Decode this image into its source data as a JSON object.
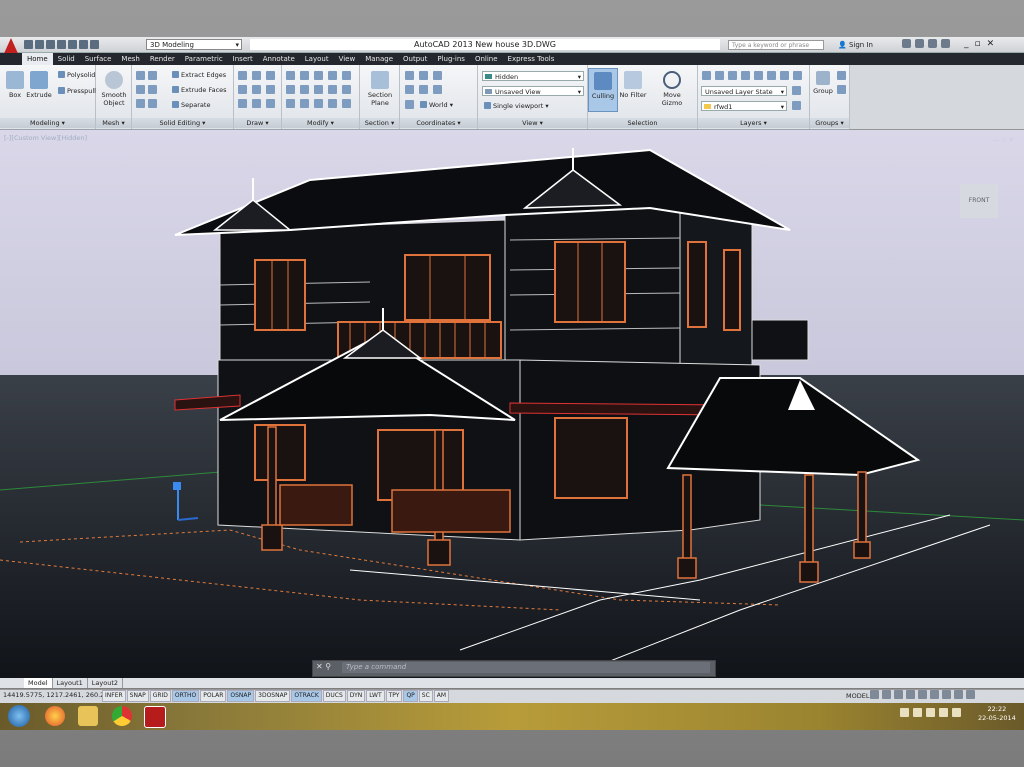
{
  "window": {
    "title": "AutoCAD 2013    New house 3D.DWG",
    "workspace": "3D Modeling",
    "search_placeholder": "Type a keyword or phrase",
    "sign_in": "Sign In",
    "controls": [
      "_",
      "▫",
      "✕"
    ]
  },
  "tabs": [
    "Home",
    "Solid",
    "Surface",
    "Mesh",
    "Render",
    "Parametric",
    "Insert",
    "Annotate",
    "Layout",
    "View",
    "Manage",
    "Output",
    "Plug-ins",
    "Online",
    "Express Tools"
  ],
  "ribbon": {
    "modeling": {
      "label": "Modeling",
      "box": "Box",
      "extrude": "Extrude",
      "polysolid": "Polysolid",
      "presspull": "Presspull"
    },
    "mesh": {
      "label": "Mesh",
      "smooth_object": "Smooth Object"
    },
    "solid_editing": {
      "label": "Solid Editing",
      "extract_edges": "Extract Edges",
      "extrude_faces": "Extrude Faces",
      "separate": "Separate"
    },
    "draw": {
      "label": "Draw"
    },
    "modify": {
      "label": "Modify"
    },
    "section": {
      "label": "Section",
      "section_plane": "Section Plane"
    },
    "coordinates": {
      "label": "Coordinates",
      "world": "World"
    },
    "view": {
      "label": "View",
      "visual_style": "Hidden",
      "saved_view": "Unsaved View",
      "viewport": "Single viewport"
    },
    "selection": {
      "label": "Selection",
      "culling": "Culling",
      "no_filter": "No Filter",
      "move_gizmo": "Move Gizmo"
    },
    "layers": {
      "label": "Layers",
      "layer_state": "Unsaved Layer State",
      "current_layer": "rfwd1"
    },
    "groups": {
      "label": "Groups",
      "group": "Group"
    }
  },
  "viewport": {
    "label": "[-][Custom View][Hidden]",
    "viewcube": "FRONT",
    "background_color": "#161a1f",
    "sky_color": "#d9d7e8",
    "wire_color": "#ffffff",
    "wood_color": "#e0733c"
  },
  "command": {
    "prompt": "Type a command"
  },
  "layout_tabs": [
    "Model",
    "Layout1",
    "Layout2"
  ],
  "status": {
    "coords": "14419.5775, 1217.2461, 260.2638",
    "toggles": [
      "INFER",
      "SNAP",
      "GRID",
      "ORTHO",
      "POLAR",
      "OSNAP",
      "3DOSNAP",
      "OTRACK",
      "DUCS",
      "DYN",
      "LWT",
      "TPY",
      "QP",
      "SC",
      "AM"
    ],
    "active_toggles": [
      "ORTHO",
      "OSNAP",
      "OTRACK",
      "QP"
    ],
    "model": "MODEL"
  },
  "taskbar": {
    "time": "22:22",
    "date": "22-05-2014"
  }
}
